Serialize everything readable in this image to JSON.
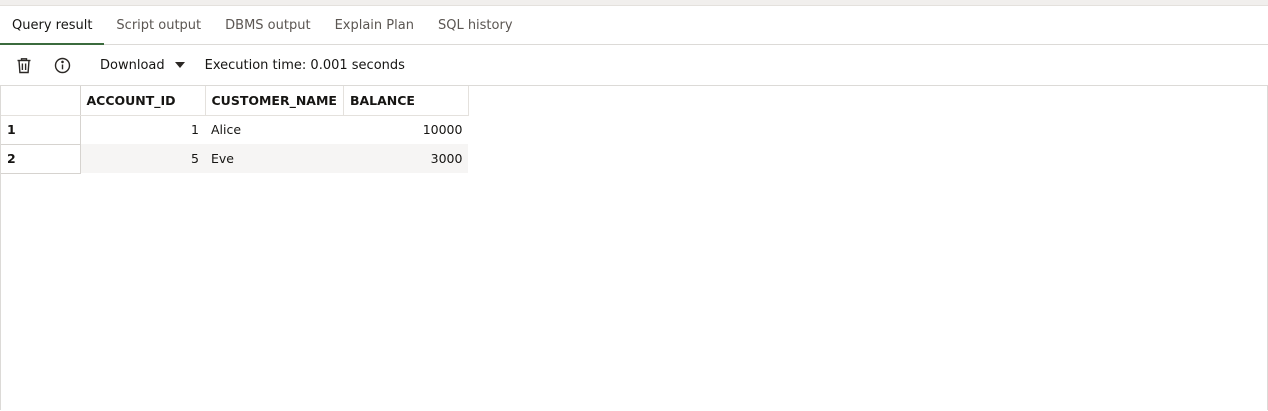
{
  "tabs": [
    {
      "label": "Query result",
      "active": true
    },
    {
      "label": "Script output",
      "active": false
    },
    {
      "label": "DBMS output",
      "active": false
    },
    {
      "label": "Explain Plan",
      "active": false
    },
    {
      "label": "SQL history",
      "active": false
    }
  ],
  "toolbar": {
    "download_label": "Download",
    "execution_time": "Execution time: 0.001 seconds",
    "icons": [
      "trash-icon",
      "info-icon",
      "caret-down-icon"
    ]
  },
  "results": {
    "columns": [
      "ACCOUNT_ID",
      "CUSTOMER_NAME",
      "BALANCE"
    ],
    "rows": [
      {
        "rownum": "1",
        "cells": [
          "1",
          "Alice",
          "10000"
        ]
      },
      {
        "rownum": "2",
        "cells": [
          "5",
          "Eve",
          "3000"
        ]
      }
    ]
  },
  "colors": {
    "active_tab_underline": "#3b6b3d",
    "alt_row_bg": "#f6f5f4"
  }
}
